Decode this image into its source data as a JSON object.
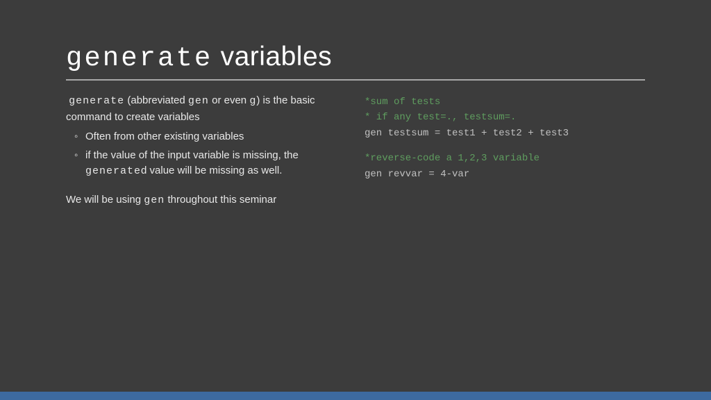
{
  "title": {
    "mono": "generate",
    "rest": " variables"
  },
  "intro": {
    "p1a": "generate",
    "p1b": " (abbreviated ",
    "p1c": "gen",
    "p1d": " or even ",
    "p1e": "g",
    "p1f": ")  is the basic command to create variables"
  },
  "bullets": {
    "b1": "Often from other existing variables",
    "b2a": "if the value of the input variable is missing, the ",
    "b2b": "generate",
    "b2c": "d value will be missing as well."
  },
  "outro": {
    "a": "We will be using ",
    "b": "gen",
    "c": " throughout this seminar"
  },
  "code": {
    "block1": {
      "c1": "*sum of tests",
      "c2": "* if any test=., testsum=.",
      "l1": "gen testsum = test1 + test2 + test3"
    },
    "block2": {
      "c1": "*reverse-code a 1,2,3 variable",
      "l1": "gen revvar = 4-var"
    }
  }
}
